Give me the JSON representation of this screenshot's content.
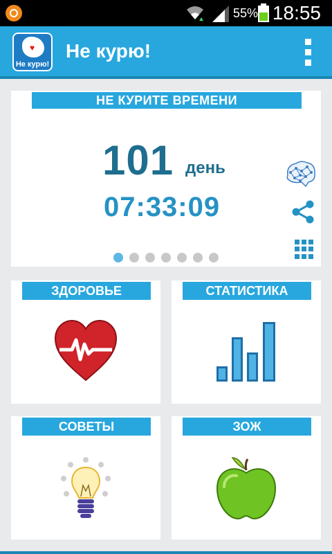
{
  "status_bar": {
    "battery_percent": "55%",
    "time": "18:55"
  },
  "action_bar": {
    "logo_text": "Не курю!",
    "title": "Не курю!"
  },
  "timer_card": {
    "header": "НЕ КУРИТЕ ВРЕМЕНИ",
    "days_value": "101",
    "days_label": "день",
    "time_value": "07:33:09",
    "pager": {
      "total": 7,
      "active_index": 0
    }
  },
  "tiles": {
    "health": "ЗДОРОВЬЕ",
    "statistics": "СТАТИСТИКА",
    "tips": "СОВЕТЫ",
    "healthy_lifestyle": "ЗОЖ"
  },
  "colors": {
    "accent": "#27a7de",
    "accent_dark": "#1b86b4",
    "days_text": "#1f6e8f",
    "time_text": "#2592c4"
  }
}
